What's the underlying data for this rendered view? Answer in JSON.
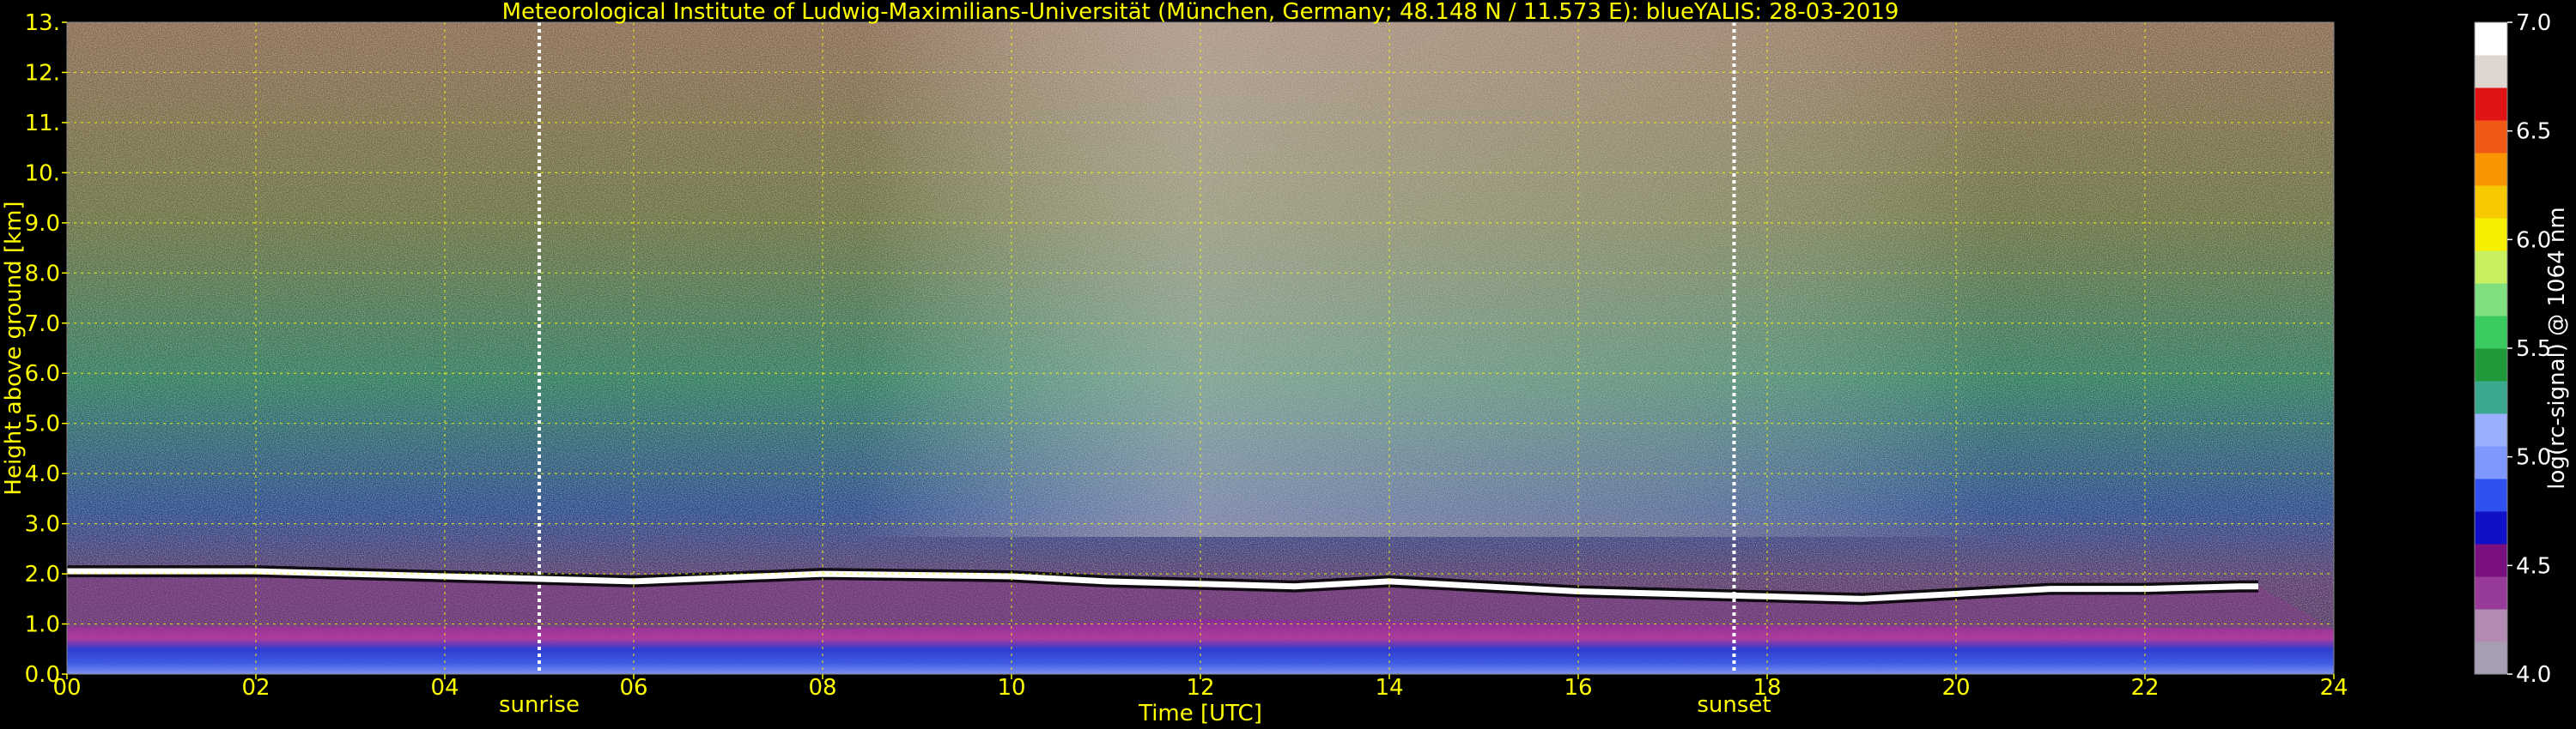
{
  "title": "Meteorological Institute of Ludwig-Maximilians-Universität (München, Germany; 48.148 N / 11.573 E):    blueYALIS: 28-03-2019",
  "chart_data": {
    "type": "heatmap",
    "title": "Meteorological Institute of Ludwig-Maximilians-Universität (München, Germany; 48.148 N / 11.573 E):    blueYALIS: 28-03-2019",
    "xlabel": "Time [UTC]",
    "ylabel": "Height above ground [km]",
    "xlim": [
      0,
      24
    ],
    "ylim": [
      0,
      13
    ],
    "xticks": [
      "00",
      "02",
      "04",
      "06",
      "08",
      "10",
      "12",
      "14",
      "16",
      "18",
      "20",
      "22",
      "24"
    ],
    "yticks": [
      "0.0",
      "1.0",
      "2.0",
      "3.0",
      "4.0",
      "5.0",
      "6.0",
      "7.0",
      "8.0",
      "9.0",
      "10.",
      "11.",
      "12.",
      "13."
    ],
    "grid": true,
    "annotations": [
      {
        "label": "sunrise",
        "x": 5.0
      },
      {
        "label": "sunset",
        "x": 17.65
      }
    ],
    "colorbar": {
      "label": "log(rc-signal) @ 1064 nm",
      "range": [
        4.0,
        7.0
      ],
      "ticks": [
        "4.0",
        "4.5",
        "5.0",
        "5.5",
        "6.0",
        "6.5",
        "7.0"
      ],
      "colors": [
        "#a79eb3",
        "#b18bb1",
        "#983a9a",
        "#7a0f7f",
        "#1010c8",
        "#3050f0",
        "#7f98ff",
        "#9ab0ff",
        "#3aa88e",
        "#1f9a3a",
        "#3acb60",
        "#7fe07f",
        "#c8f060",
        "#f6f000",
        "#f8c800",
        "#f79600",
        "#f05a14",
        "#e01414",
        "#ded6d0",
        "#ffffff"
      ]
    },
    "features": {
      "cloud_base_height_km": [
        {
          "x": 0,
          "y": 2.05
        },
        {
          "x": 2,
          "y": 2.05
        },
        {
          "x": 4,
          "y": 1.95
        },
        {
          "x": 6,
          "y": 1.85
        },
        {
          "x": 8,
          "y": 2.0
        },
        {
          "x": 10,
          "y": 1.95
        },
        {
          "x": 11,
          "y": 1.85
        },
        {
          "x": 12,
          "y": 1.8
        },
        {
          "x": 13,
          "y": 1.75
        },
        {
          "x": 14,
          "y": 1.85
        },
        {
          "x": 15,
          "y": 1.75
        },
        {
          "x": 16,
          "y": 1.65
        },
        {
          "x": 17,
          "y": 1.6
        },
        {
          "x": 18,
          "y": 1.55
        },
        {
          "x": 19,
          "y": 1.5
        },
        {
          "x": 20,
          "y": 1.6
        },
        {
          "x": 21,
          "y": 1.7
        },
        {
          "x": 22,
          "y": 1.7
        },
        {
          "x": 23,
          "y": 1.75
        },
        {
          "x": 23.2,
          "y": 1.75
        }
      ],
      "boundary_layer_top_km": [
        {
          "x": 0,
          "y": 0.95
        },
        {
          "x": 4,
          "y": 0.95
        },
        {
          "x": 8,
          "y": 0.9
        },
        {
          "x": 10.5,
          "y": 1.0
        },
        {
          "x": 12,
          "y": 1.1
        },
        {
          "x": 16,
          "y": 1.0
        },
        {
          "x": 20,
          "y": 0.95
        },
        {
          "x": 24,
          "y": 0.9
        }
      ]
    }
  }
}
